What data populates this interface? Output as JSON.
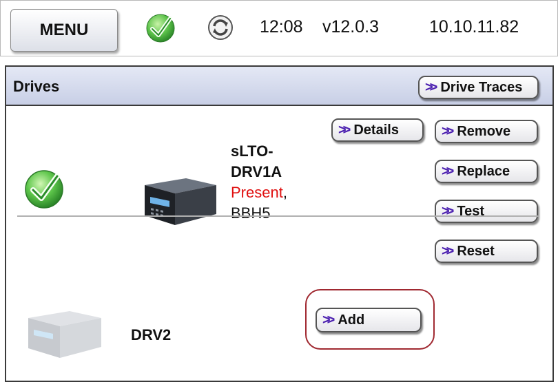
{
  "topbar": {
    "menu_label": "MENU",
    "time": "12:08",
    "version": "v12.0.3",
    "ip": "10.10.11.82",
    "status_icon": "green-check-icon",
    "sync_icon": "sync-icon"
  },
  "drives_panel": {
    "title": "Drives",
    "drive_traces_label": "Drive Traces",
    "drives": [
      {
        "name_line1": "sLTO-",
        "name_line2": "DRV1A",
        "status": "Present",
        "status_suffix": ",",
        "code": "BBH5",
        "actions": {
          "details": "Details",
          "remove": "Remove",
          "replace": "Replace",
          "test": "Test",
          "reset": "Reset"
        }
      },
      {
        "name": "DRV2",
        "actions": {
          "add": "Add"
        }
      }
    ]
  },
  "colors": {
    "accent_chevron": "#4b1fb0",
    "present_red": "#e01010",
    "highlight_border": "#a02830",
    "header_bg": "#c8cfe6"
  }
}
